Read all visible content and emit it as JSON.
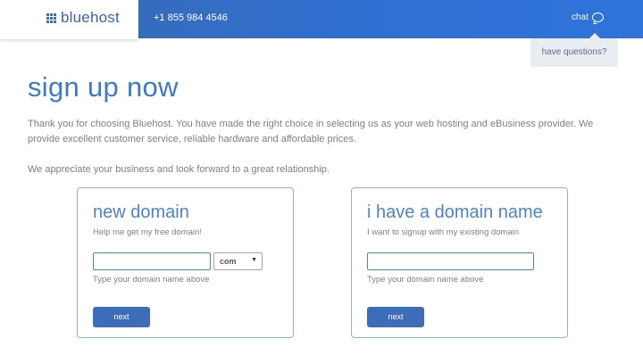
{
  "header": {
    "logo_text": "bluehost",
    "phone": "+1 855 984 4546",
    "chat_label": "chat",
    "help_label": "have questions?"
  },
  "page": {
    "title": "sign up now",
    "paragraph1": "Thank you for choosing Bluehost. You have made the right choice in selecting us as your web hosting and eBusiness provider. We provide excellent customer service, reliable hardware and affordable prices.",
    "paragraph2": "We appreciate your business and look forward to a great relationship."
  },
  "new_domain": {
    "title": "new domain",
    "subtitle": "Help me get my free domain!",
    "input_value": "",
    "tld_selected": "com",
    "hint": "Type your domain name above",
    "button_label": "next"
  },
  "existing_domain": {
    "title": "i have a domain name",
    "subtitle": "I want to signup with my existing domain",
    "input_value": "",
    "hint": "Type your domain name above",
    "button_label": "next"
  },
  "colors": {
    "brand_blue": "#3a64b6",
    "header_gradient_start": "#3a6ab2",
    "header_gradient_end": "#2f73db",
    "title_blue": "#3d78c9",
    "button_blue": "#3d6cb9",
    "card_border": "#8eb1de"
  },
  "icons": {
    "logo": "grid-icon",
    "chat": "chat-bubble-icon",
    "select": "chevron-down-icon"
  }
}
